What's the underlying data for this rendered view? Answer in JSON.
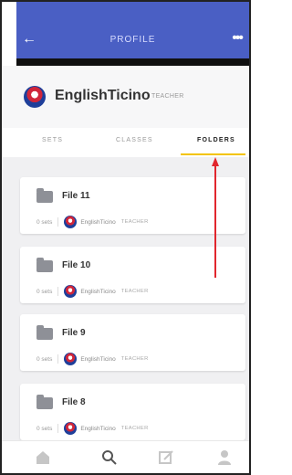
{
  "appbar": {
    "title": "PROFILE",
    "back_icon": "arrow-left-icon",
    "more_icon": "more-horizontal-icon"
  },
  "profile": {
    "username": "EnglishTicino",
    "role": "TEACHER"
  },
  "tabs": [
    {
      "label": "SETS",
      "active": false
    },
    {
      "label": "CLASSES",
      "active": false
    },
    {
      "label": "FOLDERS",
      "active": true
    }
  ],
  "folders": [
    {
      "title": "File 11",
      "sets": "0 sets",
      "owner": "EnglishTicino",
      "owner_role": "TEACHER"
    },
    {
      "title": "File 10",
      "sets": "0 sets",
      "owner": "EnglishTicino",
      "owner_role": "TEACHER"
    },
    {
      "title": "File 9",
      "sets": "0 sets",
      "owner": "EnglishTicino",
      "owner_role": "TEACHER"
    },
    {
      "title": "File 8",
      "sets": "0 sets",
      "owner": "EnglishTicino",
      "owner_role": "TEACHER"
    }
  ],
  "bottom_nav": [
    {
      "icon": "home-icon"
    },
    {
      "icon": "search-icon"
    },
    {
      "icon": "create-icon"
    },
    {
      "icon": "account-icon"
    }
  ],
  "colors": {
    "appbar": "#4a5fc4",
    "active_underline": "#f3c400",
    "arrow": "#e1262d"
  }
}
